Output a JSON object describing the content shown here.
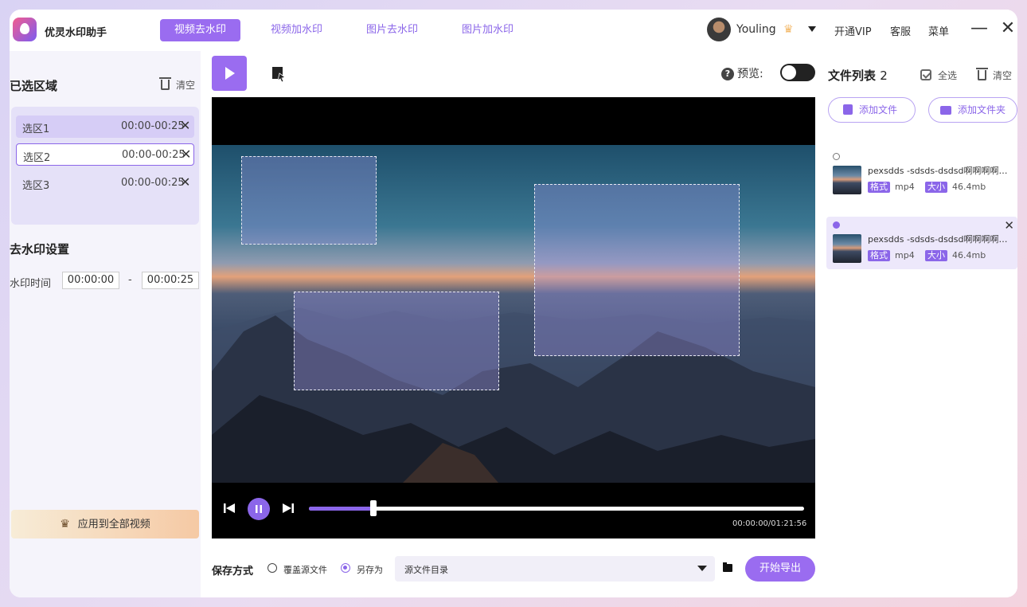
{
  "app": {
    "name": "优灵水印助手"
  },
  "nav_tabs": [
    {
      "label": "视频去水印",
      "active": true
    },
    {
      "label": "视频加水印",
      "active": false
    },
    {
      "label": "图片去水印",
      "active": false
    },
    {
      "label": "图片加水印",
      "active": false
    }
  ],
  "user": {
    "name": "Youling"
  },
  "top_links": {
    "vip": "开通VIP",
    "service": "客服",
    "menu": "菜单"
  },
  "window_controls": {
    "minimize": "—",
    "close": "✕"
  },
  "left": {
    "regions_title": "已选区域",
    "clear_label": "清空",
    "regions": [
      {
        "name": "选区1",
        "time": "00:00-00:25"
      },
      {
        "name": "选区2",
        "time": "00:00-00:25"
      },
      {
        "name": "选区3",
        "time": "00:00-00:25"
      }
    ],
    "remove_glyph": "✕",
    "settings_title": "去水印设置",
    "time_label": "水印时间",
    "time_start": "00:00:00",
    "time_sep": "-",
    "time_end": "00:00:25",
    "apply_label": "应用到全部视频"
  },
  "toolbar": {
    "preview_label": "预览:",
    "preview_on": false
  },
  "player": {
    "timecode": "00:00:00/01:21:56",
    "progress": 0.13,
    "watermark_regions": 3
  },
  "save": {
    "label": "保存方式",
    "overwrite_label": "覆盖源文件",
    "save_as_label": "另存为",
    "selected": "save_as",
    "directory": "源文件目录",
    "export_label": "开始导出"
  },
  "right": {
    "title": "文件列表",
    "count": "2",
    "select_all": "全选",
    "clear_label": "清空",
    "add_file": "添加文件",
    "add_folder": "添加文件夹",
    "files": [
      {
        "name": "pexsdds -sdsds-dsdsd啊啊啊啊啊啊啊",
        "format_tag": "格式",
        "format": "mp4",
        "size_tag": "大小",
        "size": "46.4mb",
        "selected": false
      },
      {
        "name": "pexsdds -sdsds-dsdsd啊啊啊啊啊啊啊",
        "format_tag": "格式",
        "format": "mp4",
        "size_tag": "大小",
        "size": "46.4mb",
        "selected": true
      }
    ]
  },
  "colors": {
    "accent": "#9a6cf0",
    "panel": "#f5f4fb"
  }
}
